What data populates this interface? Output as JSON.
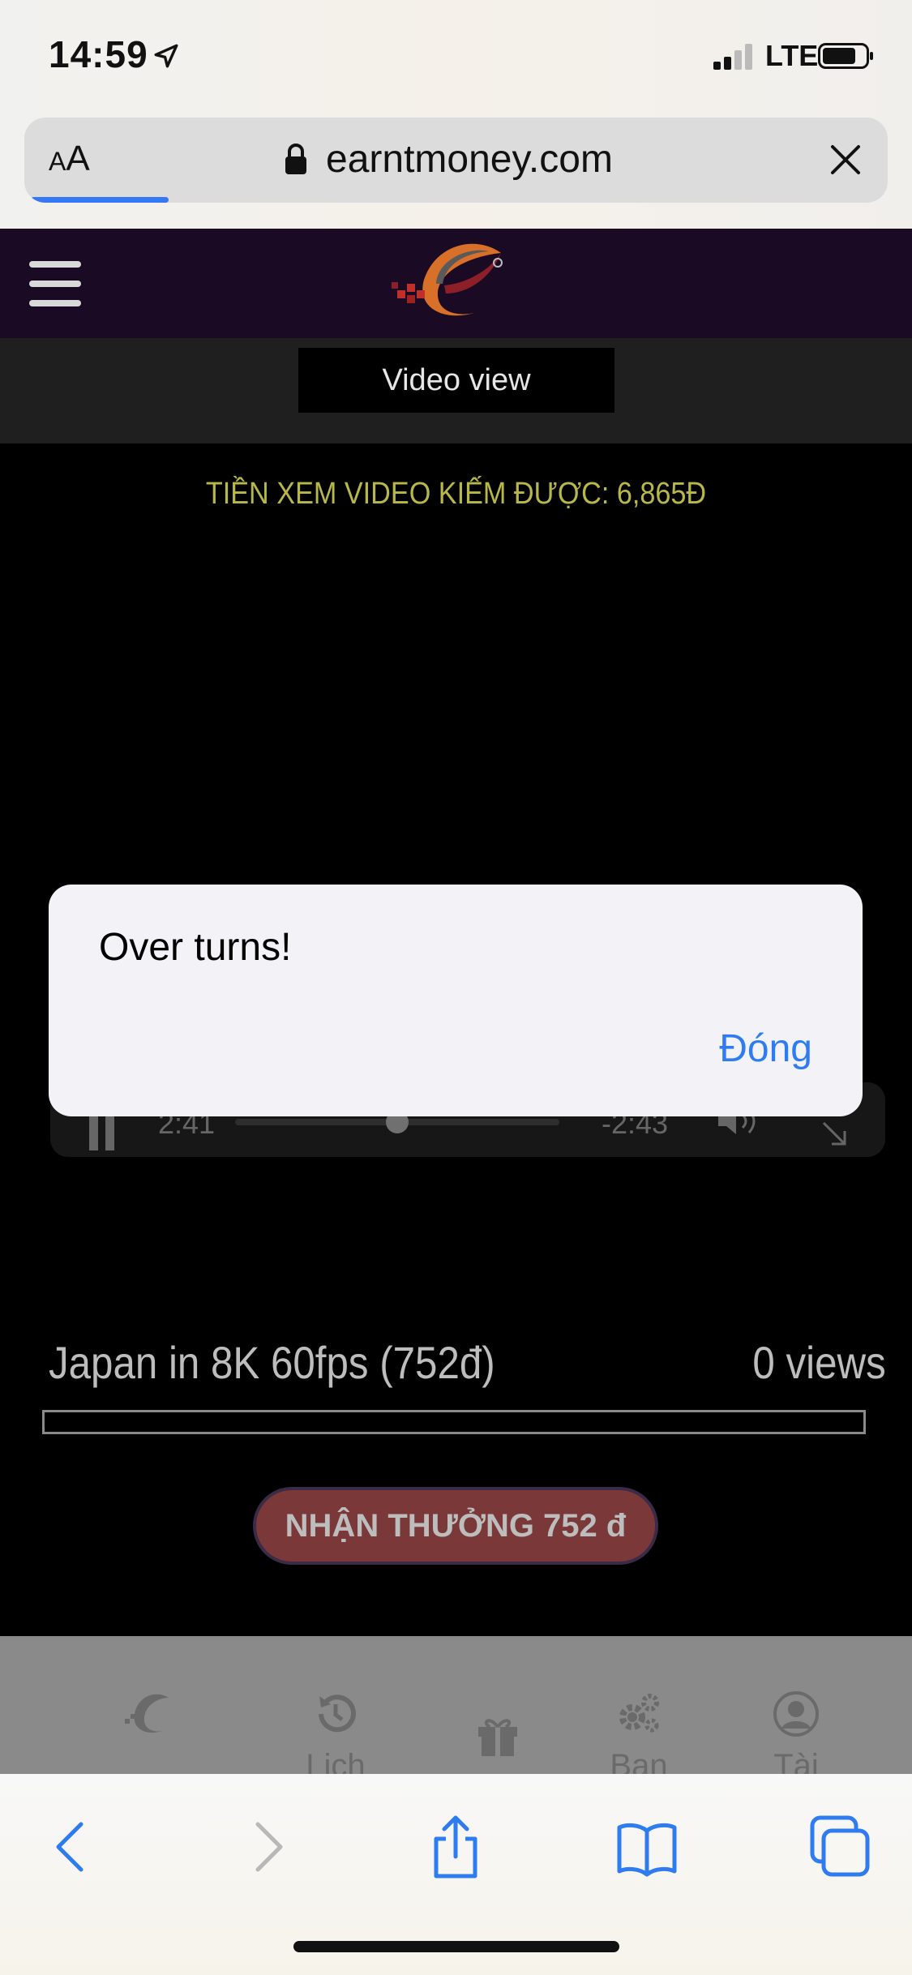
{
  "status_bar": {
    "time": "14:59",
    "network": "LTE"
  },
  "browser": {
    "text_size_label_small": "A",
    "text_size_label_large": "A",
    "url": "earntmoney.com",
    "load_progress": 0.16
  },
  "site": {
    "tab_button": "Video view",
    "earned_text": "TIỀN XEM VIDEO KIẾM ĐƯỢC: 6,865Đ"
  },
  "player": {
    "elapsed": "2:41",
    "remaining": "-2:43",
    "position_fraction": 0.5
  },
  "dialog": {
    "message": "Over turns!",
    "button": "Đóng"
  },
  "video": {
    "title": "Japan in 8K 60fps (752đ)",
    "views": "0 views",
    "progress_fraction": 0,
    "reward_button": "NHẬN THƯỞNG 752 đ"
  },
  "bottom_nav": {
    "items": [
      {
        "label": "",
        "icon": "logo-icon"
      },
      {
        "label": "Lịch",
        "icon": "history-icon"
      },
      {
        "label": "",
        "icon": "gift-icon"
      },
      {
        "label": "Bạn",
        "icon": "gears-icon"
      },
      {
        "label": "Tài",
        "icon": "user-icon"
      }
    ]
  },
  "colors": {
    "accent_blue": "#2f7cf0",
    "site_header": "#1a0a24",
    "earned_text": "#b8b84a",
    "reward_button": "#7a3838"
  }
}
